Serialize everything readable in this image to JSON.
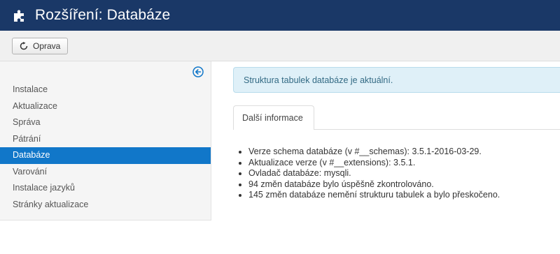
{
  "header": {
    "title": "Rozšíření: Databáze"
  },
  "toolbar": {
    "repair_label": "Oprava"
  },
  "sidebar": {
    "items": [
      {
        "label": "Instalace",
        "active": false
      },
      {
        "label": "Aktualizace",
        "active": false
      },
      {
        "label": "Správa",
        "active": false
      },
      {
        "label": "Pátrání",
        "active": false
      },
      {
        "label": "Databáze",
        "active": true
      },
      {
        "label": "Varování",
        "active": false
      },
      {
        "label": "Instalace jazyků",
        "active": false
      },
      {
        "label": "Stránky aktualizace",
        "active": false
      }
    ]
  },
  "main": {
    "alert": "Struktura tabulek databáze je aktuální.",
    "tab_label": "Další informace",
    "info": [
      "Verze schema databáze (v #__schemas): 3.5.1-2016-03-29.",
      "Aktualizace verze (v #__extensions): 3.5.1.",
      "Ovladač databáze: mysqli.",
      "94 změn databáze bylo úspěšně zkontrolováno.",
      "145 změn databáze nemění strukturu tabulek a bylo přeskočeno."
    ]
  },
  "colors": {
    "header_bg": "#1a3867",
    "active_item": "#1177c9",
    "alert_bg": "#dff0f8",
    "alert_text": "#336a84"
  }
}
